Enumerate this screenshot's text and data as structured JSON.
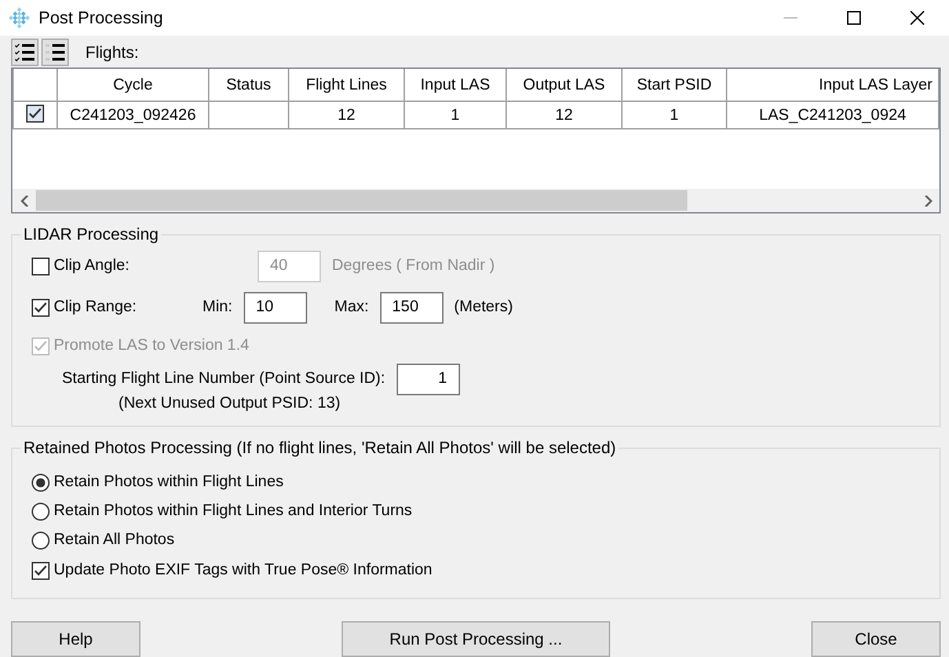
{
  "window": {
    "title": "Post Processing"
  },
  "toolbar": {
    "label": "Flights:"
  },
  "table": {
    "columns": [
      "Cycle",
      "Status",
      "Flight Lines",
      "Input LAS",
      "Output LAS",
      "Start PSID",
      "Input LAS Layer"
    ],
    "rows": [
      {
        "checked": true,
        "cells": [
          "C241203_092426",
          "",
          "12",
          "1",
          "12",
          "1",
          "LAS_C241203_0924"
        ]
      }
    ]
  },
  "lidar": {
    "title": "LIDAR Processing",
    "clip_angle": {
      "label": "Clip Angle:",
      "checked": false,
      "value": "40",
      "unit": "Degrees ( From Nadir )"
    },
    "clip_range": {
      "label": "Clip Range:",
      "checked": true,
      "min_label": "Min:",
      "min": "10",
      "max_label": "Max:",
      "max": "150",
      "unit": "(Meters)"
    },
    "promote": {
      "label": "Promote LAS to Version 1.4",
      "checked": true,
      "disabled": true
    },
    "start_line": {
      "label": "Starting Flight Line Number (Point Source ID):",
      "value": "1",
      "note": "(Next Unused Output PSID: 13)"
    }
  },
  "retained": {
    "title": "Retained Photos Processing  (If no flight lines, 'Retain All Photos' will be selected)",
    "options": [
      {
        "label": "Retain Photos within Flight Lines",
        "selected": true
      },
      {
        "label": "Retain Photos within Flight Lines and Interior Turns",
        "selected": false
      },
      {
        "label": "Retain All Photos",
        "selected": false
      }
    ],
    "update_exif": {
      "label": "Update Photo EXIF Tags with True Pose® Information",
      "checked": true
    }
  },
  "buttons": [
    "Help",
    "Run Post Processing ...",
    "Close"
  ]
}
